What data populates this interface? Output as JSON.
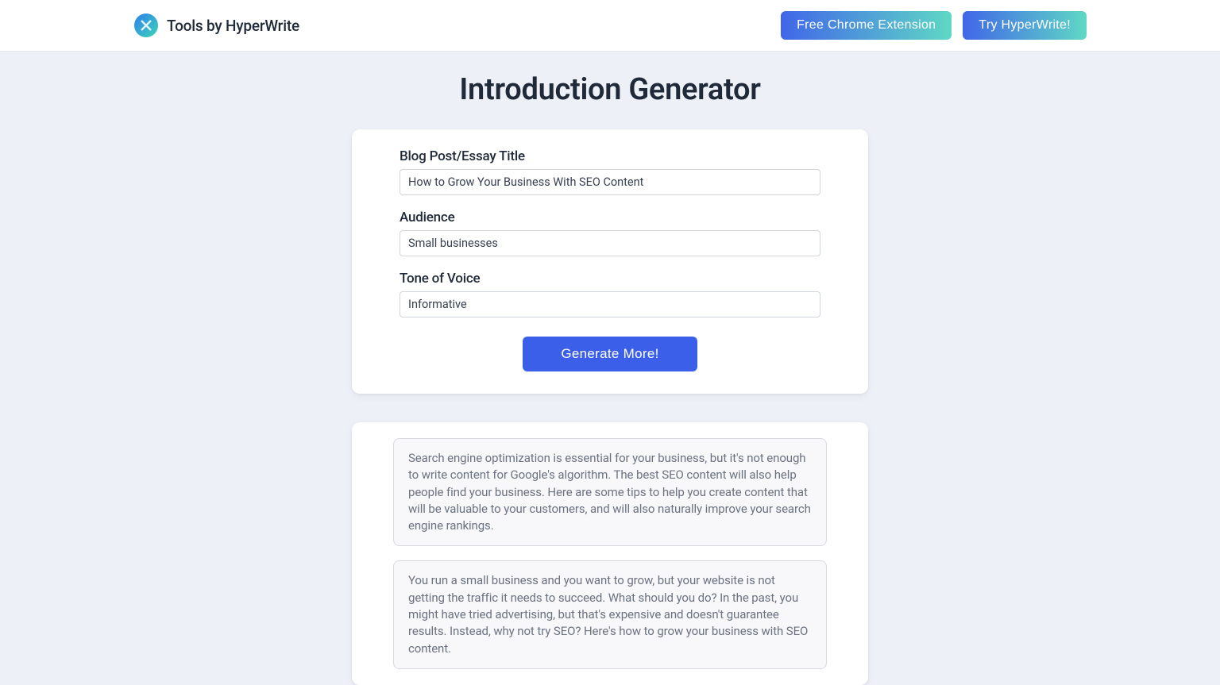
{
  "header": {
    "brand": "Tools by HyperWrite",
    "buttons": {
      "extension": "Free Chrome Extension",
      "try": "Try HyperWrite!"
    }
  },
  "page": {
    "title": "Introduction Generator"
  },
  "form": {
    "title_label": "Blog Post/Essay Title",
    "title_value": "How to Grow Your Business With SEO Content",
    "audience_label": "Audience",
    "audience_value": "Small businesses",
    "tone_label": "Tone of Voice",
    "tone_value": "Informative",
    "generate_button": "Generate More!"
  },
  "results": [
    "Search engine optimization is essential for your business, but it's not enough to write content for Google's algorithm. The best SEO content will also help people find your business. Here are some tips to help you create content that will be valuable to your customers, and will also naturally improve your search engine rankings.",
    "You run a small business and you want to grow, but your website is not getting the traffic it needs to succeed. What should you do? In the past, you might have tried advertising, but that's expensive and doesn't guarantee results. Instead, why not try SEO? Here's how to grow your business with SEO content."
  ]
}
